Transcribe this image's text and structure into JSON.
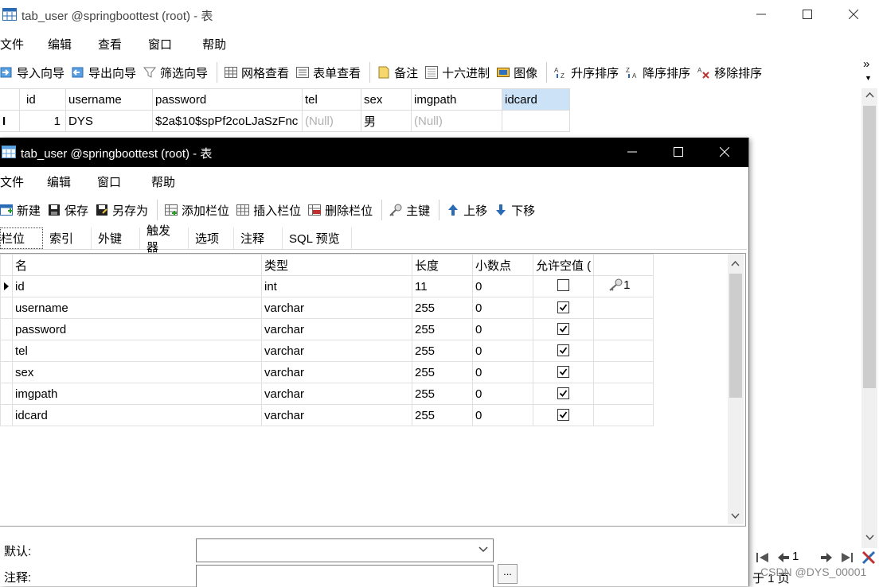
{
  "back_window": {
    "title": "tab_user @springboottest (root) - 表",
    "menu": [
      "文件",
      "编辑",
      "查看",
      "窗口",
      "帮助"
    ],
    "toolbar": [
      {
        "label": "导入向导",
        "icon": "import-wizard-icon"
      },
      {
        "label": "导出向导",
        "icon": "export-wizard-icon"
      },
      {
        "label": "筛选向导",
        "icon": "filter-icon"
      },
      {
        "label": "网格查看",
        "icon": "grid-view-icon"
      },
      {
        "label": "表单查看",
        "icon": "form-view-icon"
      },
      {
        "label": "备注",
        "icon": "memo-icon"
      },
      {
        "label": "十六进制",
        "icon": "hex-icon"
      },
      {
        "label": "图像",
        "icon": "image-icon"
      },
      {
        "label": "升序排序",
        "icon": "sort-asc-icon"
      },
      {
        "label": "降序排序",
        "icon": "sort-desc-icon"
      },
      {
        "label": "移除排序",
        "icon": "remove-sort-icon"
      }
    ],
    "overflow": "»",
    "grid_columns": [
      "id",
      "username",
      "password",
      "tel",
      "sex",
      "imgpath",
      "idcard"
    ],
    "grid_row": {
      "id": "1",
      "username": "DYS",
      "password": "$2a$10$spPf2coLJaSzFnc",
      "tel": "(Null)",
      "sex": "男",
      "imgpath": "(Null)",
      "idcard": ""
    },
    "pager": {
      "page_input": "1",
      "page_text": "于 1 页"
    },
    "watermark": "CSDN @DYS_00001"
  },
  "front_window": {
    "title": "tab_user @springboottest (root) - 表",
    "menu": [
      "文件",
      "编辑",
      "窗口",
      "帮助"
    ],
    "toolbar": [
      {
        "label": "新建",
        "icon": "new-icon"
      },
      {
        "label": "保存",
        "icon": "save-icon"
      },
      {
        "label": "另存为",
        "icon": "save-as-icon"
      },
      {
        "label": "添加栏位",
        "icon": "add-field-icon"
      },
      {
        "label": "插入栏位",
        "icon": "insert-field-icon"
      },
      {
        "label": "删除栏位",
        "icon": "delete-field-icon"
      },
      {
        "label": "主键",
        "icon": "primary-key-icon"
      },
      {
        "label": "上移",
        "icon": "arrow-up-icon"
      },
      {
        "label": "下移",
        "icon": "arrow-down-icon"
      }
    ],
    "tabs": [
      "栏位",
      "索引",
      "外键",
      "触发器",
      "选项",
      "注释",
      "SQL 预览"
    ],
    "field_columns": [
      "名",
      "类型",
      "长度",
      "小数点",
      "允许空值 (",
      ""
    ],
    "fields": [
      {
        "name": "id",
        "type": "int",
        "length": "11",
        "decimals": "0",
        "nullable": false,
        "key": "1"
      },
      {
        "name": "username",
        "type": "varchar",
        "length": "255",
        "decimals": "0",
        "nullable": true,
        "key": ""
      },
      {
        "name": "password",
        "type": "varchar",
        "length": "255",
        "decimals": "0",
        "nullable": true,
        "key": ""
      },
      {
        "name": "tel",
        "type": "varchar",
        "length": "255",
        "decimals": "0",
        "nullable": true,
        "key": ""
      },
      {
        "name": "sex",
        "type": "varchar",
        "length": "255",
        "decimals": "0",
        "nullable": true,
        "key": ""
      },
      {
        "name": "imgpath",
        "type": "varchar",
        "length": "255",
        "decimals": "0",
        "nullable": true,
        "key": ""
      },
      {
        "name": "idcard",
        "type": "varchar",
        "length": "255",
        "decimals": "0",
        "nullable": true,
        "key": ""
      }
    ],
    "props": {
      "default_label": "默认:",
      "default_value": "",
      "comment_label": "注释:",
      "comment_value": "",
      "ellipsis": "..."
    }
  }
}
